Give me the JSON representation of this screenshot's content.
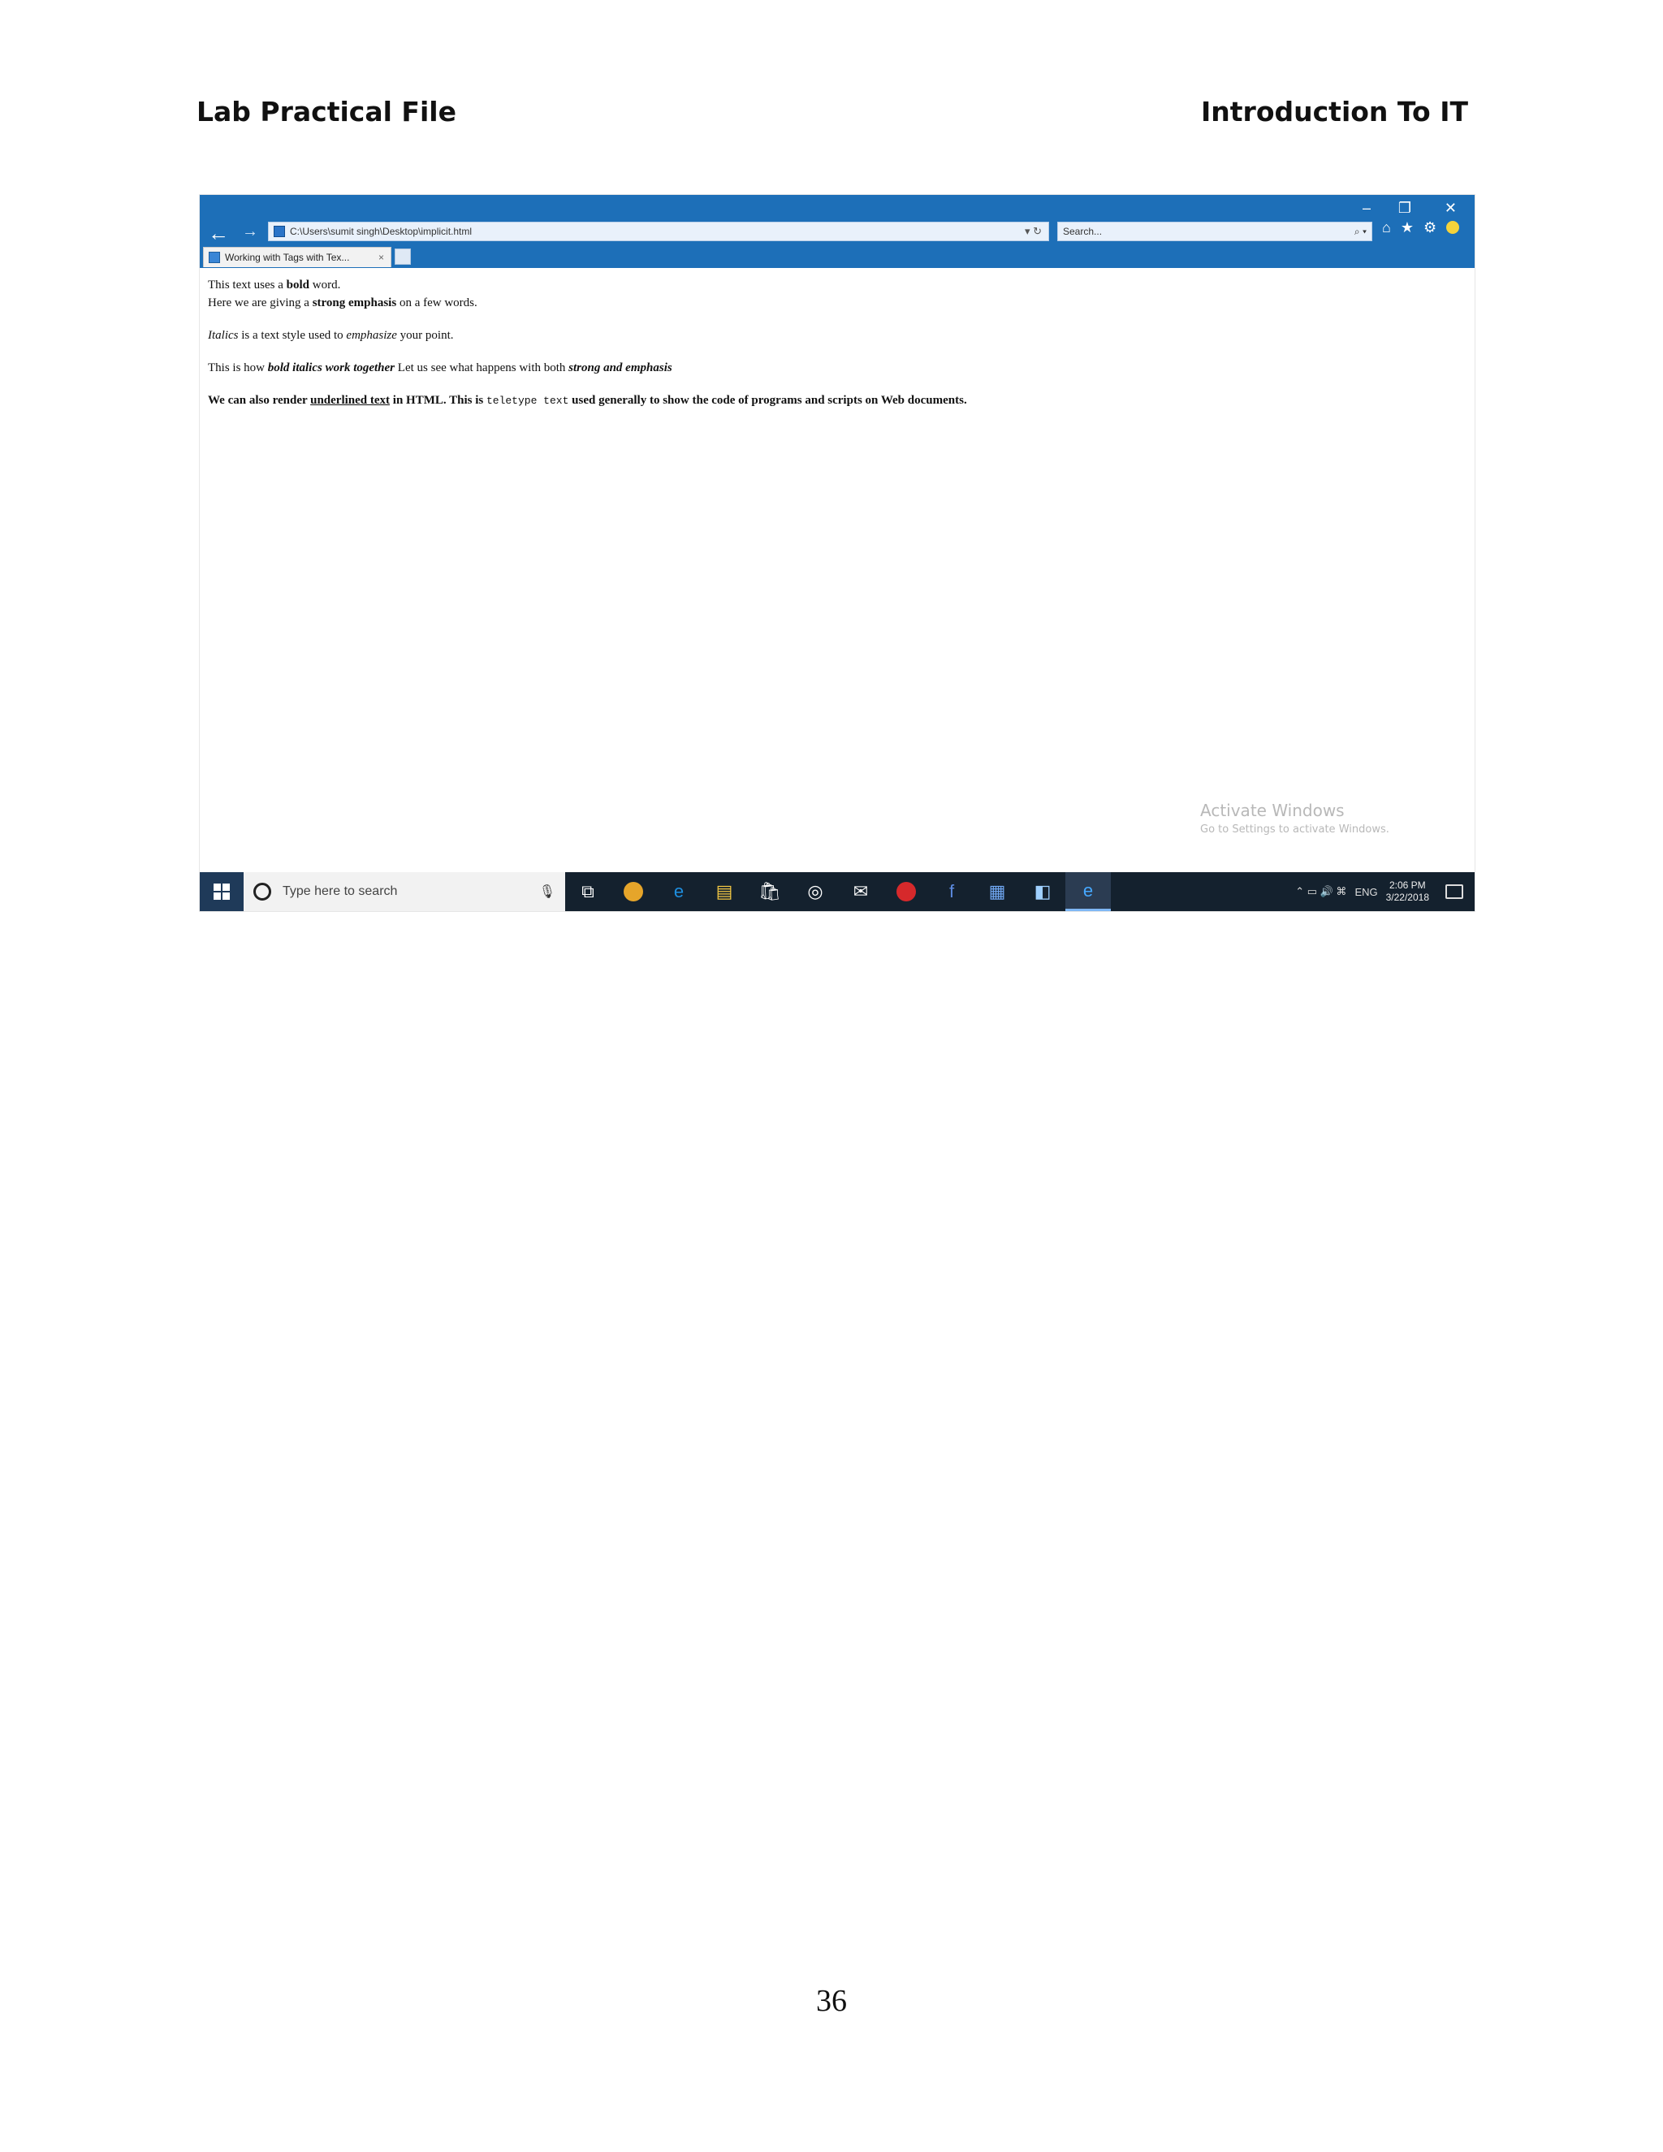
{
  "header": {
    "left": "Lab Practical File",
    "right": "Introduction To IT"
  },
  "browser": {
    "window_controls": {
      "minimize": "–",
      "restore": "❐",
      "close": "✕"
    },
    "address": "C:\\Users\\sumit singh\\Desktop\\implicit.html",
    "address_controls": "▾ ↻",
    "search_placeholder": "Search...",
    "search_controls": "⌕ ▾",
    "toolbar": {
      "home": "⌂",
      "favorites": "★",
      "settings": "⚙"
    },
    "tab": {
      "label": "Working with Tags with Tex...",
      "close": "×"
    }
  },
  "content": {
    "line1": {
      "a": "This text uses a ",
      "b": "bold",
      "c": " word."
    },
    "line2": {
      "a": "Here we are giving a ",
      "b": "strong emphasis",
      "c": " on a few words."
    },
    "line3": {
      "a": "Italics",
      "b": " is a text style used to ",
      "c": "emphasize",
      "d": " your point."
    },
    "line4": {
      "a": "This is how ",
      "b": "bold italics work together",
      "c": " Let us see what happens with both ",
      "d": "strong and emphasis"
    },
    "line5": {
      "a": "We can also render ",
      "b": "underlined text",
      "c": " in HTML. This is ",
      "d": "teletype text",
      "e": " used generally to show the code of programs and scripts on Web documents."
    }
  },
  "watermark": {
    "title": "Activate Windows",
    "subtitle": "Go to Settings to activate Windows."
  },
  "taskbar": {
    "search_text": "Type here to search",
    "mic": "🎙",
    "apps": [
      {
        "name": "task-view",
        "glyph": "⧉",
        "color": "#ffffff"
      },
      {
        "name": "chrome",
        "glyph": "",
        "color": "#e6a52a"
      },
      {
        "name": "edge",
        "glyph": "e",
        "color": "#1e8fe0"
      },
      {
        "name": "file-explorer",
        "glyph": "▤",
        "color": "#f3c744"
      },
      {
        "name": "store",
        "glyph": "🛍",
        "color": "#ffffff"
      },
      {
        "name": "media",
        "glyph": "◎",
        "color": "#ffffff"
      },
      {
        "name": "mail",
        "glyph": "✉",
        "color": "#ffffff"
      },
      {
        "name": "opera",
        "glyph": "",
        "color": "#d6292b"
      },
      {
        "name": "facebook",
        "glyph": "f",
        "color": "#5c8be0"
      },
      {
        "name": "word",
        "glyph": "▦",
        "color": "#6fa6f0"
      },
      {
        "name": "app",
        "glyph": "◧",
        "color": "#9fd0ff"
      },
      {
        "name": "internet-explorer",
        "glyph": "e",
        "color": "#46a8ff"
      }
    ],
    "tray": {
      "icons": "⌃ ▭ 🔊 ⌘",
      "lang": "ENG",
      "time": "2:06 PM",
      "date": "3/22/2018"
    }
  },
  "page_number": "36"
}
